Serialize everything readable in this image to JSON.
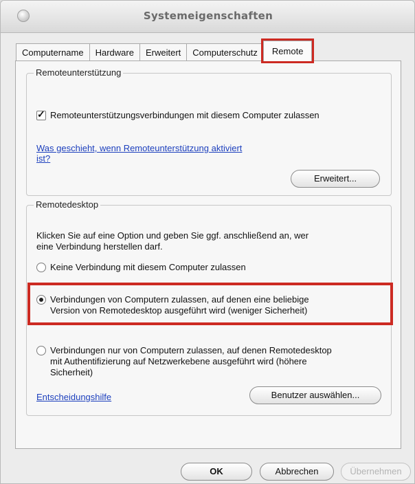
{
  "window": {
    "title": "Systemeigenschaften"
  },
  "tabs": [
    {
      "label": "Computername"
    },
    {
      "label": "Hardware"
    },
    {
      "label": "Erweitert"
    },
    {
      "label": "Computerschutz"
    },
    {
      "label": "Remote",
      "active": true
    }
  ],
  "remote_assistance": {
    "group_label": "Remoteunterstützung",
    "checkbox_label": "Remoteunterstützungsverbindungen mit diesem Computer zulassen",
    "checkbox_checked": true,
    "help_link_line1": "Was geschieht, wenn Remoteunterstützung aktiviert",
    "help_link_line2": "ist?",
    "advanced_button": "Erweitert..."
  },
  "remote_desktop": {
    "group_label": "Remotedesktop",
    "instructions_line1": "Klicken Sie auf eine Option und geben Sie ggf. anschließend an, wer",
    "instructions_line2": "eine Verbindung herstellen darf.",
    "option_none": "Keine Verbindung mit diesem Computer zulassen",
    "option_any_line1": "Verbindungen von Computern zulassen, auf denen eine beliebige",
    "option_any_line2": "Version von Remotedesktop ausgeführt wird (weniger Sicherheit)",
    "option_nla_line1": "Verbindungen nur von Computern zulassen, auf denen Remotedesktop",
    "option_nla_line2": "mit Authentifizierung auf Netzwerkebene ausgeführt wird (höhere",
    "option_nla_line3": "Sicherheit)",
    "selected_option": "any",
    "help_link": "Entscheidungshilfe",
    "select_users_button": "Benutzer auswählen..."
  },
  "footer": {
    "ok_button": "OK",
    "cancel_button": "Abbrechen",
    "apply_button": "Übernehmen"
  },
  "colors": {
    "highlight": "#cc2a22",
    "link": "#1c3fbd"
  }
}
